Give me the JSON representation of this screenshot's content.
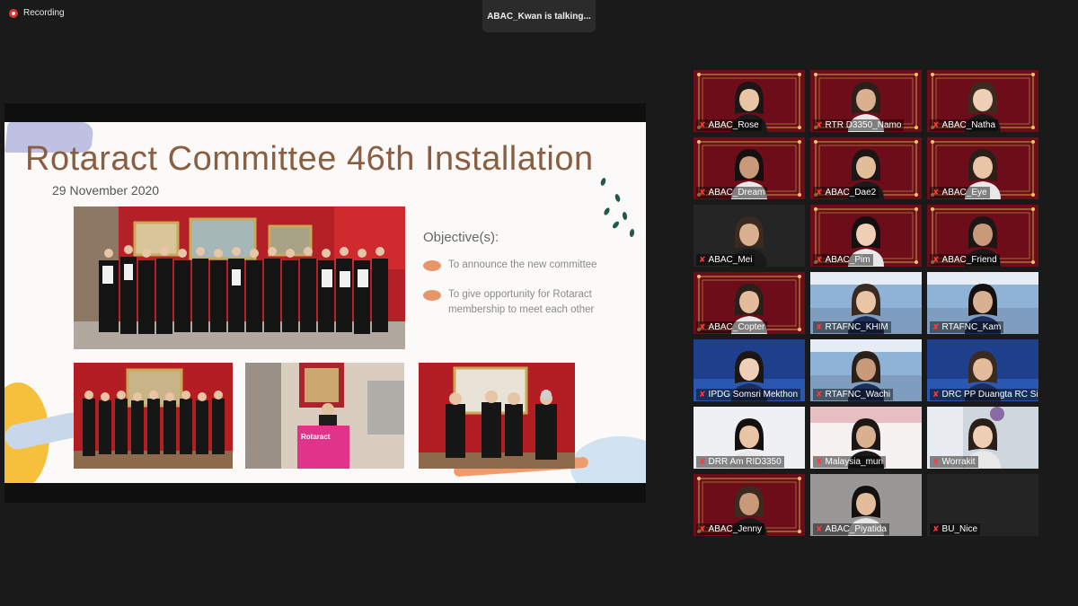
{
  "recording": {
    "label": "Recording"
  },
  "speaker": {
    "text": "ABAC_Kwan is talking..."
  },
  "slide": {
    "title": "Rotaract Committee 46th Installation",
    "date": "29 November 2020",
    "objectives_title": "Objective(s):",
    "objectives": [
      "To announce the new committee",
      "To give opportunity for Rotaract membership to meet each other"
    ],
    "banner_text": "Rotaract"
  },
  "participants": [
    {
      "name": "ABAC_Rose",
      "bg": "red"
    },
    {
      "name": "RTR D3350_Namo",
      "bg": "red"
    },
    {
      "name": "ABAC_Natha",
      "bg": "red"
    },
    {
      "name": "ABAC_Dream",
      "bg": "red"
    },
    {
      "name": "ABAC_Dae2",
      "bg": "red"
    },
    {
      "name": "ABAC_Eye",
      "bg": "red"
    },
    {
      "name": "ABAC_Mei",
      "bg": "dark"
    },
    {
      "name": "ABAC_Pim",
      "bg": "red"
    },
    {
      "name": "ABAC_Friend",
      "bg": "red"
    },
    {
      "name": "ABAC_Copter",
      "bg": "red"
    },
    {
      "name": "RTAFNC_KHIM",
      "bg": "sky"
    },
    {
      "name": "RTAFNC_Kam",
      "bg": "sky"
    },
    {
      "name": "IPDG Somsri Mekthon",
      "bg": "blue"
    },
    {
      "name": "RTAFNC_Wachi",
      "bg": "sky"
    },
    {
      "name": "DRC PP Duangta RC Silo...",
      "bg": "blue"
    },
    {
      "name": "DRR Am RID3350",
      "bg": "white"
    },
    {
      "name": "Malaysia_mun",
      "bg": "pinkwhite"
    },
    {
      "name": "Worrakit",
      "bg": "office"
    },
    {
      "name": "ABAC_Jenny",
      "bg": "red"
    },
    {
      "name": "ABAC_Piyatida",
      "bg": "grey"
    },
    {
      "name": "BU_Nice",
      "bg": "black"
    }
  ],
  "colors": {
    "accent_red": "#e0322e",
    "slide_title": "#8a5e40",
    "bullet": "#e9956a",
    "tile_red": "#6d0d1a"
  },
  "icons": {
    "mic_muted": "mic-muted-icon",
    "record": "record-icon"
  }
}
